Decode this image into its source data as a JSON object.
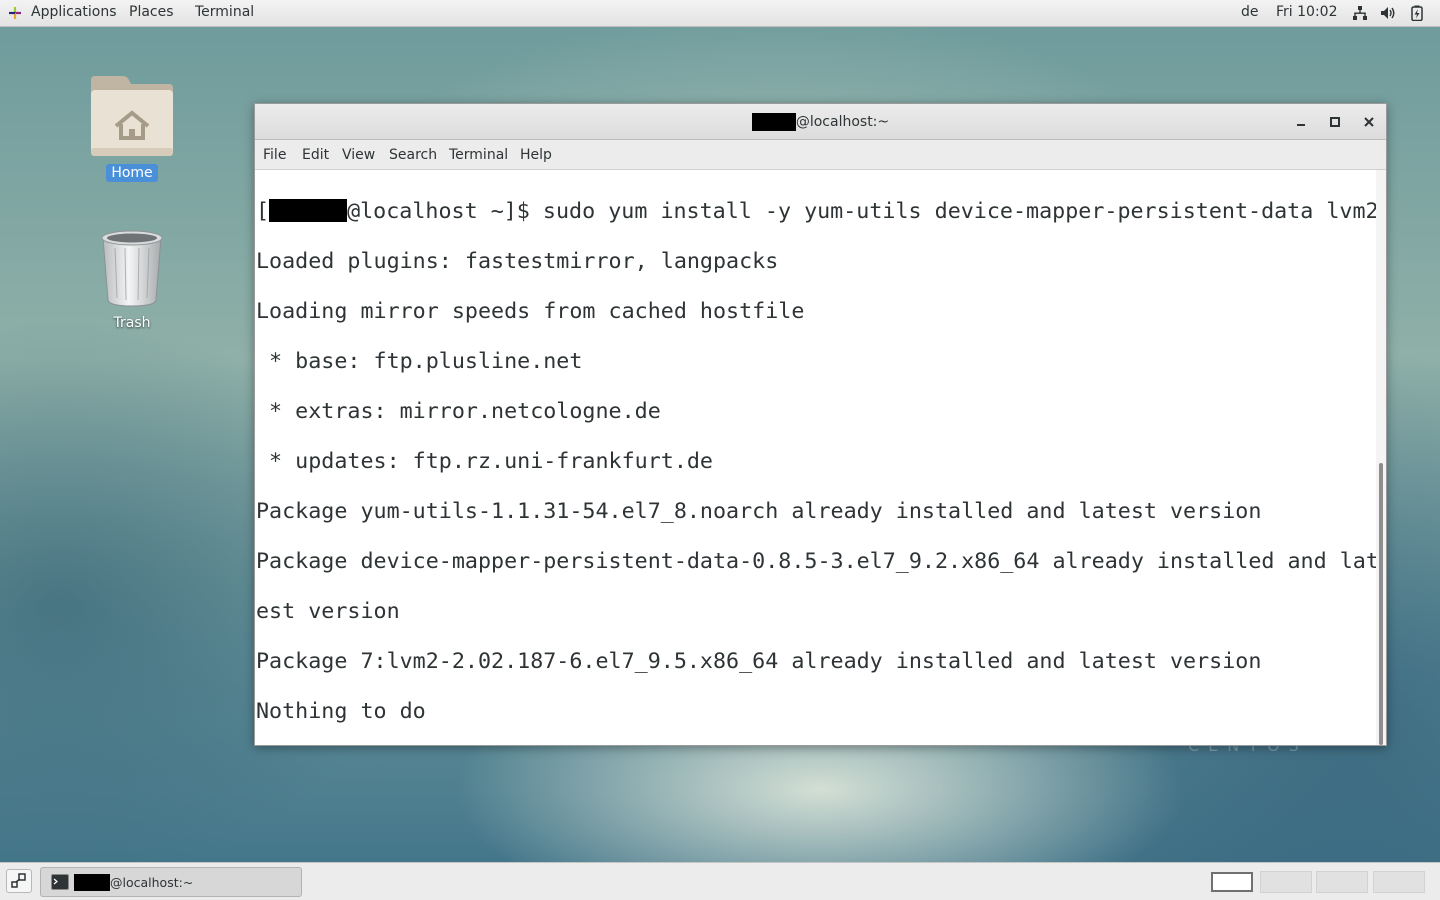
{
  "top_panel": {
    "applications": "Applications",
    "places": "Places",
    "terminal": "Terminal",
    "keyboard_layout": "de",
    "clock": "Fri 10:02",
    "icons": [
      "network-icon",
      "volume-icon",
      "battery-icon"
    ]
  },
  "desktop": {
    "icons": [
      {
        "label": "Home",
        "icon": "home-folder-icon"
      },
      {
        "label": "Trash",
        "icon": "trash-icon"
      }
    ],
    "watermark": "CENTOS"
  },
  "window": {
    "title": "@localhost:~",
    "menu": [
      "File",
      "Edit",
      "View",
      "Search",
      "Terminal",
      "Help"
    ],
    "controls": [
      "minimize-icon",
      "maximize-icon",
      "close-icon"
    ]
  },
  "terminal": {
    "prompt_open": "[",
    "prompt_host": "@localhost ~]$",
    "command": " sudo yum install -y yum-utils device-mapper-persistent-data lvm2",
    "output": [
      "Loaded plugins: fastestmirror, langpacks",
      "Loading mirror speeds from cached hostfile",
      " * base: ftp.plusline.net",
      " * extras: mirror.netcologne.de",
      " * updates: ftp.rz.uni-frankfurt.de",
      "Package yum-utils-1.1.31-54.el7_8.noarch already installed and latest version",
      "Package device-mapper-persistent-data-0.8.5-3.el7_9.2.x86_64 already installed and lat",
      "est version",
      "Package 7:lvm2-2.02.187-6.el7_9.5.x86_64 already installed and latest version",
      "Nothing to do"
    ]
  },
  "taskbar": {
    "task_label": "@localhost:~",
    "workspaces": 4,
    "active_workspace": 1
  }
}
